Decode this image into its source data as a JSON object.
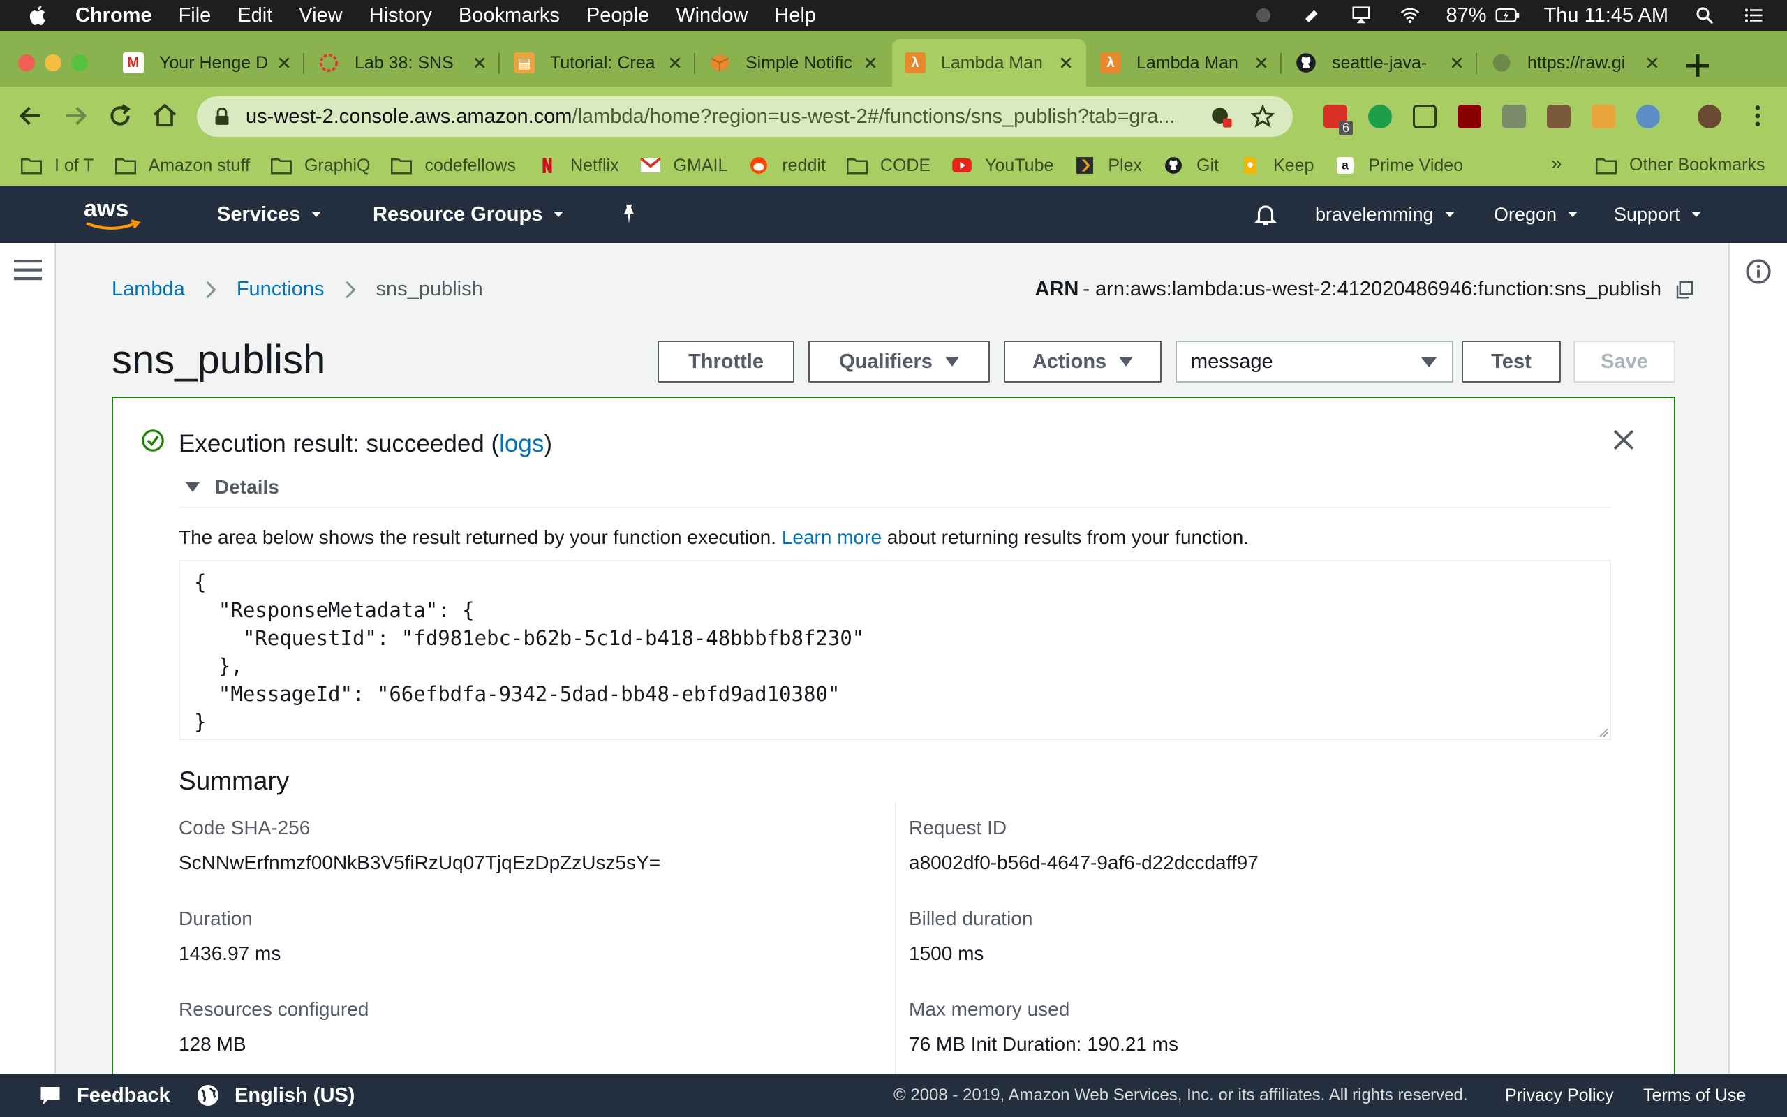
{
  "menubar": {
    "app": "Chrome",
    "items": [
      "File",
      "Edit",
      "View",
      "History",
      "Bookmarks",
      "People",
      "Window",
      "Help"
    ],
    "battery": "87%",
    "clock": "Thu 11:45 AM"
  },
  "tabs": [
    {
      "title": "Your Henge D",
      "icon": "gmail-icon",
      "active": false
    },
    {
      "title": "Lab 38: SNS",
      "icon": "canvas-icon",
      "active": false
    },
    {
      "title": "Tutorial: Crea",
      "icon": "aws-docs-icon",
      "active": false
    },
    {
      "title": "Simple Notific",
      "icon": "aws-box-icon",
      "active": false
    },
    {
      "title": "Lambda Man",
      "icon": "lambda-icon",
      "active": true
    },
    {
      "title": "Lambda Man",
      "icon": "lambda-icon",
      "active": false
    },
    {
      "title": "seattle-java-",
      "icon": "github-icon",
      "active": false
    },
    {
      "title": "https://raw.gi",
      "icon": "globe-icon",
      "active": false
    }
  ],
  "omnibox": {
    "host": "us-west-2.console.aws.amazon.com",
    "path": "/lambda/home?region=us-west-2#/functions/sns_publish?tab=gra..."
  },
  "extension_badge": "6",
  "bookmarks": [
    {
      "label": "I of T",
      "icon": "folder-icon"
    },
    {
      "label": "Amazon stuff",
      "icon": "folder-icon"
    },
    {
      "label": "GraphiQ",
      "icon": "folder-icon"
    },
    {
      "label": "codefellows",
      "icon": "folder-icon"
    },
    {
      "label": "Netflix",
      "icon": "netflix-icon"
    },
    {
      "label": "GMAIL",
      "icon": "gmail-icon"
    },
    {
      "label": "reddit",
      "icon": "reddit-icon"
    },
    {
      "label": "CODE",
      "icon": "folder-icon"
    },
    {
      "label": "YouTube",
      "icon": "youtube-icon"
    },
    {
      "label": "Plex",
      "icon": "plex-icon"
    },
    {
      "label": "Git",
      "icon": "github-icon"
    },
    {
      "label": "Keep",
      "icon": "keep-icon"
    },
    {
      "label": "Prime Video",
      "icon": "amazon-icon"
    }
  ],
  "bookmarks_more": "»",
  "bookmarks_other": "Other Bookmarks",
  "aws_nav": {
    "logo": "aws",
    "services": "Services",
    "resource_groups": "Resource Groups",
    "account": "bravelemming",
    "region": "Oregon",
    "support": "Support"
  },
  "breadcrumb": {
    "lambda": "Lambda",
    "functions": "Functions",
    "current": "sns_publish"
  },
  "arn": {
    "label": "ARN",
    "value": "- arn:aws:lambda:us-west-2:412020486946:function:sns_publish"
  },
  "page_title": "sns_publish",
  "buttons": {
    "throttle": "Throttle",
    "qualifiers": "Qualifiers",
    "actions": "Actions",
    "test_event": "message",
    "test": "Test",
    "save": "Save"
  },
  "result": {
    "title_prefix": "Execution result: succeeded (",
    "logs_link": "logs",
    "title_suffix": ")",
    "details": "Details",
    "explain_prefix": "The area below shows the result returned by your function execution. ",
    "learn_more": "Learn more",
    "explain_suffix": " about returning results from your function.",
    "output": "{\n  \"ResponseMetadata\": {\n    \"RequestId\": \"fd981ebc-b62b-5c1d-b418-48bbbfb8f230\"\n  },\n  \"MessageId\": \"66efbdfa-9342-5dad-bb48-ebfd9ad10380\"\n}"
  },
  "summary": {
    "title": "Summary",
    "code_sha_label": "Code SHA-256",
    "code_sha_value": "ScNNwErfnmzf00NkB3V5fiRzUq07TjqEzDpZzUsz5sY=",
    "request_id_label": "Request ID",
    "request_id_value": "a8002df0-b56d-4647-9af6-d22dccdaff97",
    "duration_label": "Duration",
    "duration_value": "1436.97 ms",
    "billed_label": "Billed duration",
    "billed_value": "1500 ms",
    "resources_label": "Resources configured",
    "resources_value": "128 MB",
    "memory_label": "Max memory used",
    "memory_value": "76 MB Init Duration: 190.21 ms"
  },
  "footer": {
    "feedback": "Feedback",
    "language": "English (US)",
    "copyright": "© 2008 - 2019, Amazon Web Services, Inc. or its affiliates. All rights reserved.",
    "privacy": "Privacy Policy",
    "terms": "Terms of Use"
  },
  "colors": {
    "chrome_frame": "#8ab34f",
    "chrome_toolbar": "#a8cd63",
    "aws_nav": "#232f3e",
    "link": "#0073bb",
    "success": "#1d8102"
  }
}
